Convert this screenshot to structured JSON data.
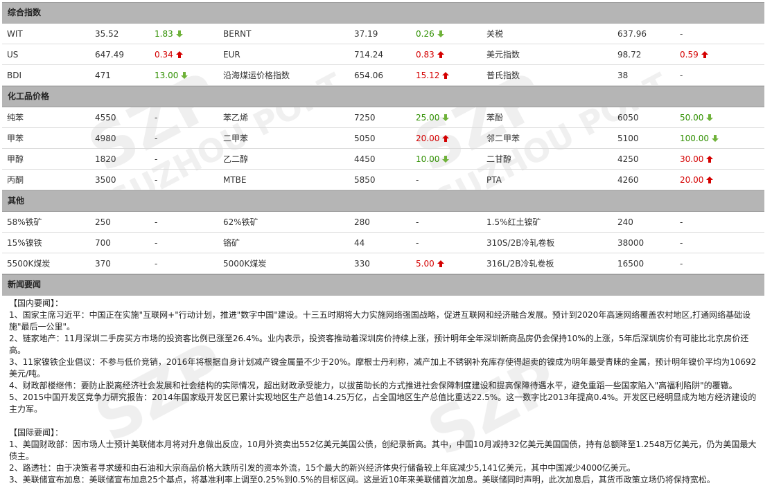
{
  "sections": {
    "composite": "综合指数",
    "chemical": "化工品价格",
    "other": "其他",
    "news": "新闻要闻"
  },
  "composite_rows": [
    [
      {
        "n": "WIT",
        "v": "35.52",
        "c": "1.83",
        "d": "down"
      },
      {
        "n": "BERNT",
        "v": "37.19",
        "c": "0.26",
        "d": "down"
      },
      {
        "n": "关税",
        "v": "637.96",
        "c": "-",
        "d": "none"
      }
    ],
    [
      {
        "n": "US",
        "v": "647.49",
        "c": "0.34",
        "d": "up"
      },
      {
        "n": "EUR",
        "v": "714.24",
        "c": "0.83",
        "d": "up"
      },
      {
        "n": "美元指数",
        "v": "98.72",
        "c": "0.59",
        "d": "up"
      }
    ],
    [
      {
        "n": "BDI",
        "v": "471",
        "c": "13.00",
        "d": "down"
      },
      {
        "n": "沿海煤运价格指数",
        "v": "654.06",
        "c": "15.12",
        "d": "up"
      },
      {
        "n": "普氏指数",
        "v": "38",
        "c": "-",
        "d": "none"
      }
    ]
  ],
  "chemical_rows": [
    [
      {
        "n": "纯苯",
        "v": "4550",
        "c": "-",
        "d": "none"
      },
      {
        "n": "苯乙烯",
        "v": "7250",
        "c": "25.00",
        "d": "down"
      },
      {
        "n": "苯酚",
        "v": "6050",
        "c": "50.00",
        "d": "down"
      }
    ],
    [
      {
        "n": "甲苯",
        "v": "4980",
        "c": "-",
        "d": "none"
      },
      {
        "n": "二甲苯",
        "v": "5050",
        "c": "20.00",
        "d": "up"
      },
      {
        "n": "邻二甲苯",
        "v": "5100",
        "c": "100.00",
        "d": "down"
      }
    ],
    [
      {
        "n": "甲醇",
        "v": "1820",
        "c": "-",
        "d": "none"
      },
      {
        "n": "乙二醇",
        "v": "4450",
        "c": "10.00",
        "d": "down"
      },
      {
        "n": "二甘醇",
        "v": "4250",
        "c": "30.00",
        "d": "up"
      }
    ],
    [
      {
        "n": "丙酮",
        "v": "3500",
        "c": "-",
        "d": "none"
      },
      {
        "n": "MTBE",
        "v": "5850",
        "c": "-",
        "d": "none"
      },
      {
        "n": "PTA",
        "v": "4260",
        "c": "20.00",
        "d": "up"
      }
    ]
  ],
  "other_rows": [
    [
      {
        "n": "58%铁矿",
        "v": "250",
        "c": "-",
        "d": "none"
      },
      {
        "n": "62%铁矿",
        "v": "280",
        "c": "-",
        "d": "none"
      },
      {
        "n": "1.5%红土镍矿",
        "v": "240",
        "c": "-",
        "d": "none"
      }
    ],
    [
      {
        "n": "15%镍铁",
        "v": "700",
        "c": "-",
        "d": "none"
      },
      {
        "n": "铬矿",
        "v": "44",
        "c": "-",
        "d": "none"
      },
      {
        "n": "310S/2B冷轧卷板",
        "v": "38000",
        "c": "-",
        "d": "none"
      }
    ],
    [
      {
        "n": "5500K煤炭",
        "v": "370",
        "c": "-",
        "d": "none"
      },
      {
        "n": "5000K煤炭",
        "v": "330",
        "c": "5.00",
        "d": "up"
      },
      {
        "n": "316L/2B冷轧卷板",
        "v": "16500",
        "c": "-",
        "d": "none"
      }
    ]
  ],
  "news": {
    "domestic_title": "【国内要闻】：",
    "domestic": [
      "1、国家主席习近平：中国正在实施\"互联网+\"行动计划，推进\"数字中国\"建设。十三五时期将大力实施网络强国战略，促进互联网和经济融合发展。预计到2020年高速网络覆盖农村地区,打通网络基础设施\"最后一公里\"。",
      "2、链家地产：11月深圳二手房买方市场的投资客比例已涨至26.4%。业内表示，投资客推动着深圳房价持续上涨，预计明年全年深圳新商品房仍会保持10%的上涨，5年后深圳房价有可能比北京房价还高。",
      "3、11家镍铁企业倡议：不参与低价竞销，2016年将根据自身计划减产镍金属量不少于20%。摩根士丹利称，减产加上不锈钢补充库存使得超卖的镍成为明年最受青睐的金属，预计明年镍价平均为10692美元/吨。",
      "4、财政部楼继伟：要防止脱离经济社会发展和社会结构的实际情况，超出财政承受能力，以拔苗助长的方式推进社会保障制度建设和提高保障待遇水平，避免重蹈一些国家陷入\"高福利陷阱\"的覆辙。",
      "5、2015中国开发区竞争力研究报告：2014年国家级开发区已累计实现地区生产总值14.25万亿，占全国地区生产总值比重达22.5%。这一数字比2013年提高0.4%。开发区已经明显成为地方经济建设的主力军。"
    ],
    "intl_title": "【国际要闻】：",
    "intl": [
      "1、美国财政部：因市场人士预计美联储本月将对升息做出反应，10月外资卖出552亿美元美国公债，创纪录新高。其中，中国10月减持32亿美元美国国债，持有总额降至1.2548万亿美元，仍为美国最大债主。",
      "2、路透社：由于决策者寻求缓和由石油和大宗商品价格大跌所引发的资本外流，15个最大的新兴经济体央行储备较上年底减少5,141亿美元，其中中国减少4000亿美元。",
      "3、美联储宣布加息：美联储宣布加息25个基点，将基准利率上调至0.25%到0.5%的目标区间。这是近10年来美联储首次加息。美联储同时声明，此次加息后，其货币政策立场仍将保持宽松。"
    ]
  },
  "colors": {
    "up": "#d40000",
    "down": "#2f8f00",
    "header_bg": "#b5b5b5"
  },
  "icons": {
    "up": "red-up-arrow-icon",
    "down": "green-down-arrow-icon"
  },
  "watermark": "SUZHOU PORT"
}
